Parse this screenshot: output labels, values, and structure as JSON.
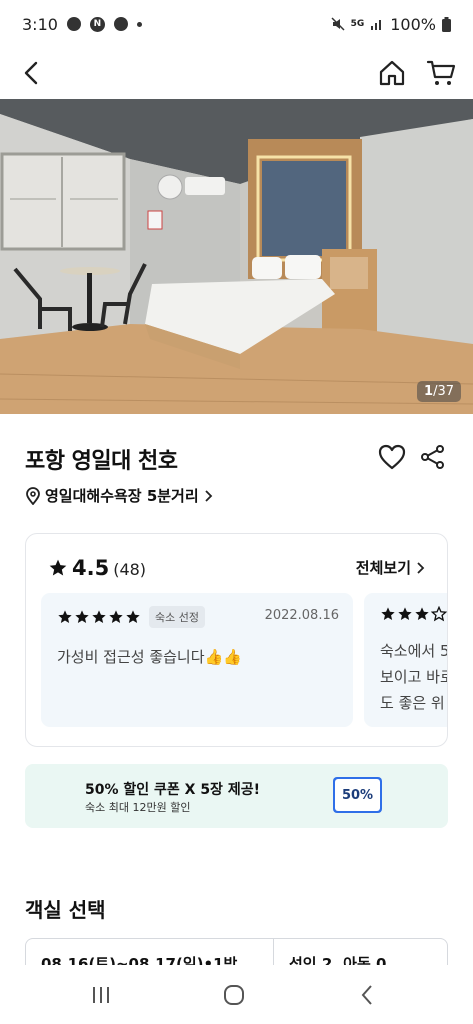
{
  "status": {
    "time": "3:10",
    "battery": "100%",
    "network": "5G"
  },
  "hero": {
    "photo_current": "1",
    "photo_total": "/37"
  },
  "property": {
    "name": "포항 영일대 천호",
    "location": "영일대해수욕장 5분거리"
  },
  "reviews": {
    "rating": "4.5",
    "count": "(48)",
    "see_all": "전체보기",
    "items": [
      {
        "stars": 5,
        "badge": "숙소 선정",
        "date": "2022.08.16",
        "text": "가성비 접근성 좋습니다👍👍"
      },
      {
        "stars": 3,
        "line1": "숙소에서 5",
        "line2": "보이고 바로",
        "line3": "도 좋은 위"
      }
    ]
  },
  "coupon": {
    "title": "50% 할인 쿠폰 X 5장 제공!",
    "subtitle": "숙소 최대 12만원 할인",
    "ticket": "50%"
  },
  "room_section": {
    "title": "객실 선택",
    "dates": "08.16(토)~08.17(일)•1박",
    "guests": "성인 2, 아동 0"
  },
  "colors": {
    "star": "#111111",
    "coupon_bg": "#eaf7f3",
    "ticket": "#2f6fe8",
    "review_bg": "#f2f7fb"
  }
}
